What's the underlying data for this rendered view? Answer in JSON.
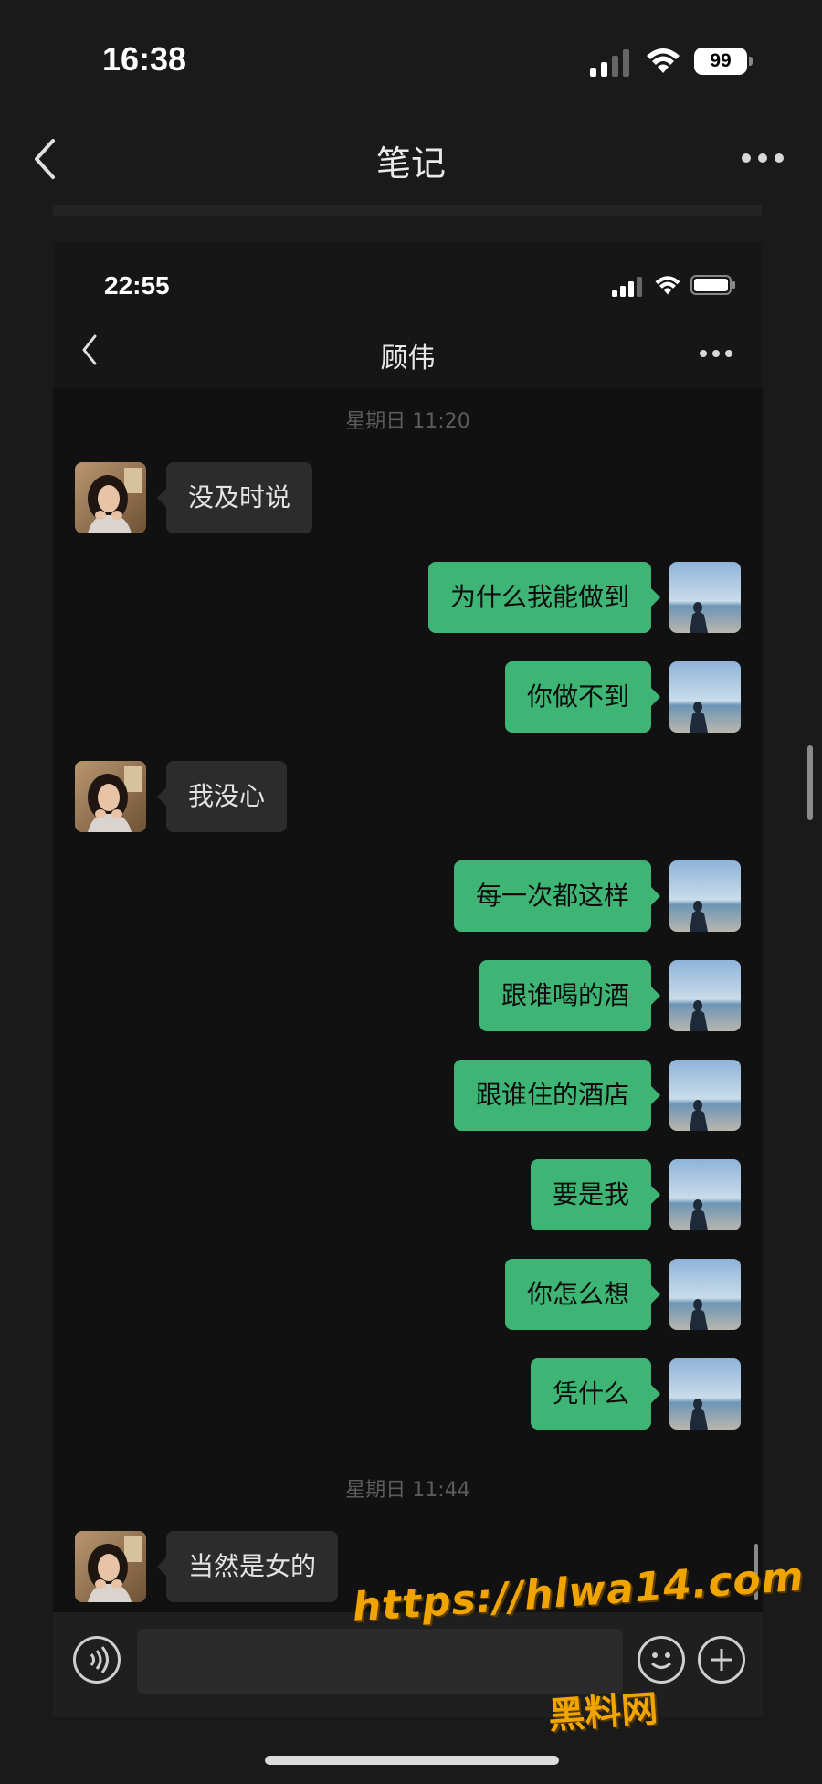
{
  "outer": {
    "time": "16:38",
    "battery": "99",
    "nav_title": "笔记"
  },
  "inner": {
    "time": "22:55",
    "chat_title": "顾伟"
  },
  "chat": {
    "stamp1": "星期日 11:20",
    "stamp2": "星期日 11:44",
    "m1": "没及时说",
    "m2": "为什么我能做到",
    "m3": "你做不到",
    "m4": "我没心",
    "m5": "每一次都这样",
    "m6": "跟谁喝的酒",
    "m7": "跟谁住的酒店",
    "m8": "要是我",
    "m9": "你怎么想",
    "m10": "凭什么",
    "m11": "当然是女的"
  },
  "watermark": {
    "url": "https://hlwa14.com",
    "name": "黑料网"
  },
  "colors": {
    "outgoing_bubble": "#3eb575",
    "incoming_bubble": "#2c2c2c",
    "watermark": "#f0a400"
  },
  "icons": [
    "back-chevron-icon",
    "more-dots-icon",
    "signal-icon",
    "wifi-icon",
    "battery-icon",
    "voice-icon",
    "emoji-icon",
    "plus-icon"
  ]
}
